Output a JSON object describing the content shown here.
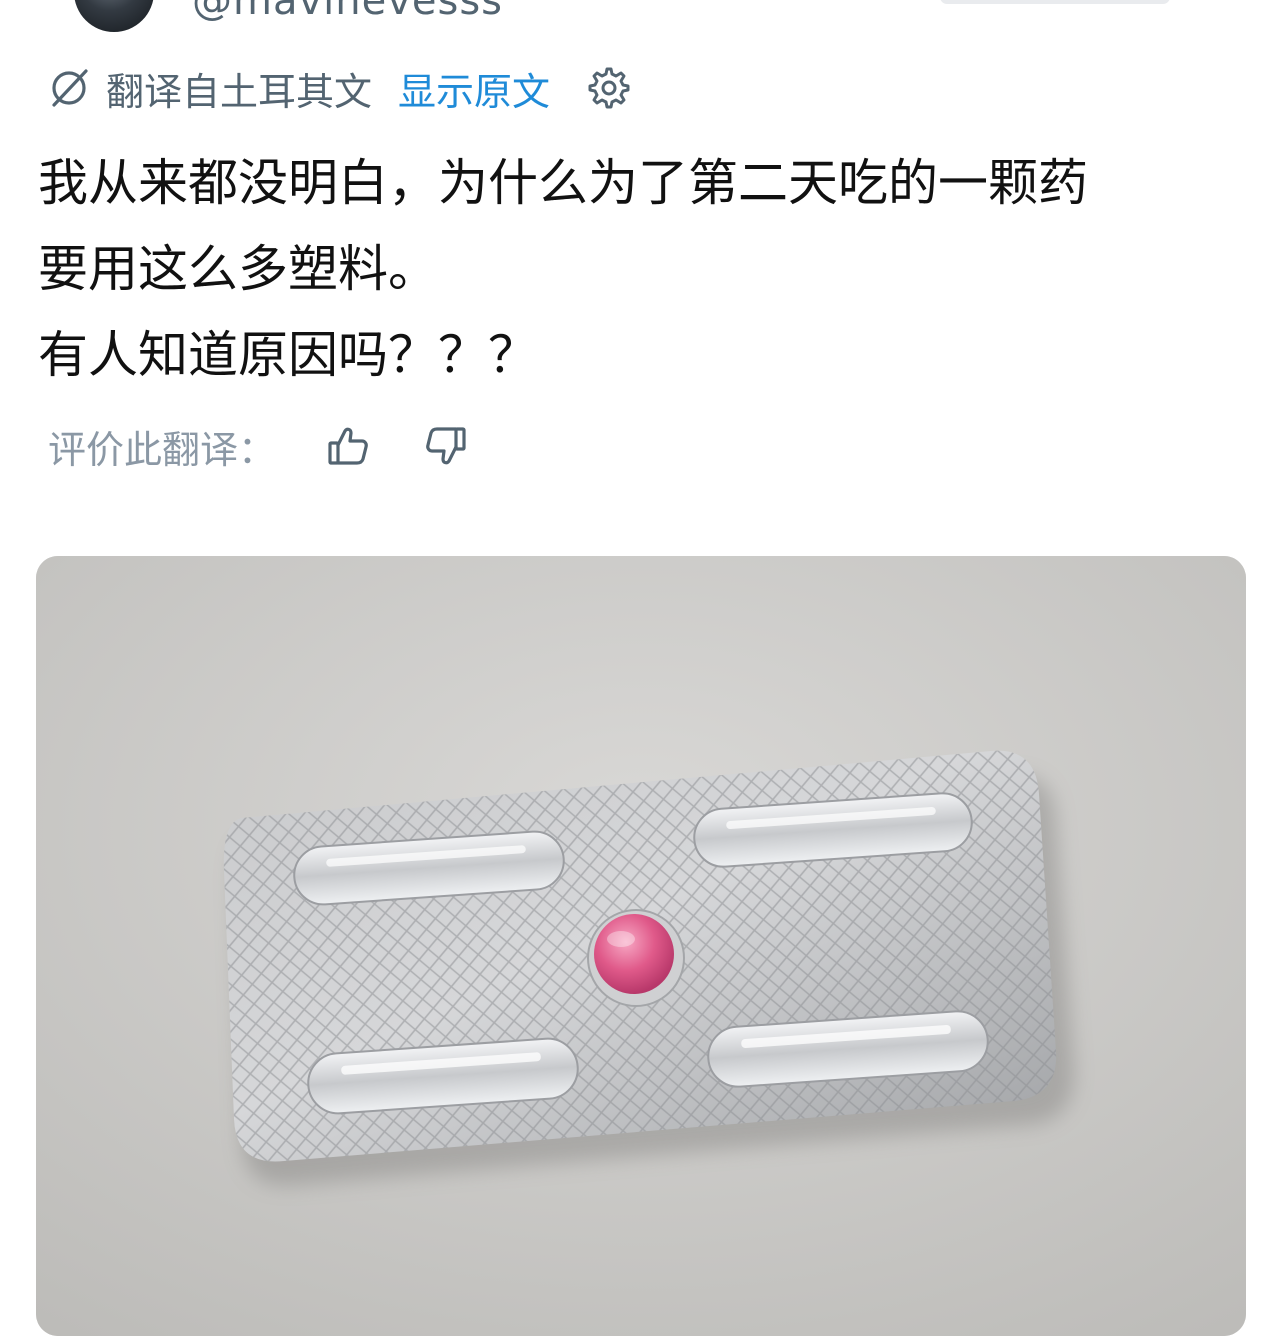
{
  "header": {
    "handle": "@mavinevesss"
  },
  "translation": {
    "translated_from": "翻译自土耳其文",
    "show_original": "显示原文",
    "translate_icon": "translate-icon",
    "settings_icon": "gear-icon"
  },
  "post": {
    "lines": [
      "我从来都没明白，为什么为了第二天吃的一颗药",
      "要用这么多塑料。",
      "有人知道原因吗？？？"
    ]
  },
  "rating": {
    "label": "评价此翻译：",
    "thumbs_up_icon": "thumbs-up-icon",
    "thumbs_down_icon": "thumbs-down-icon"
  },
  "colors": {
    "link_blue": "#1f8bd8",
    "secondary_gray": "#536471",
    "pill_pink": "#e05a8a"
  }
}
